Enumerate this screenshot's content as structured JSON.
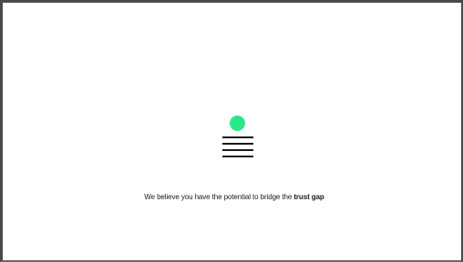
{
  "logo": {
    "icon": "green-dot-over-lines-icon",
    "dot_color": "#2ee68a",
    "line_color": "#1a1a1a",
    "line_count": 4
  },
  "tagline": {
    "text": "We believe you have the potential to bridge the",
    "emphasis": "trust gap"
  }
}
